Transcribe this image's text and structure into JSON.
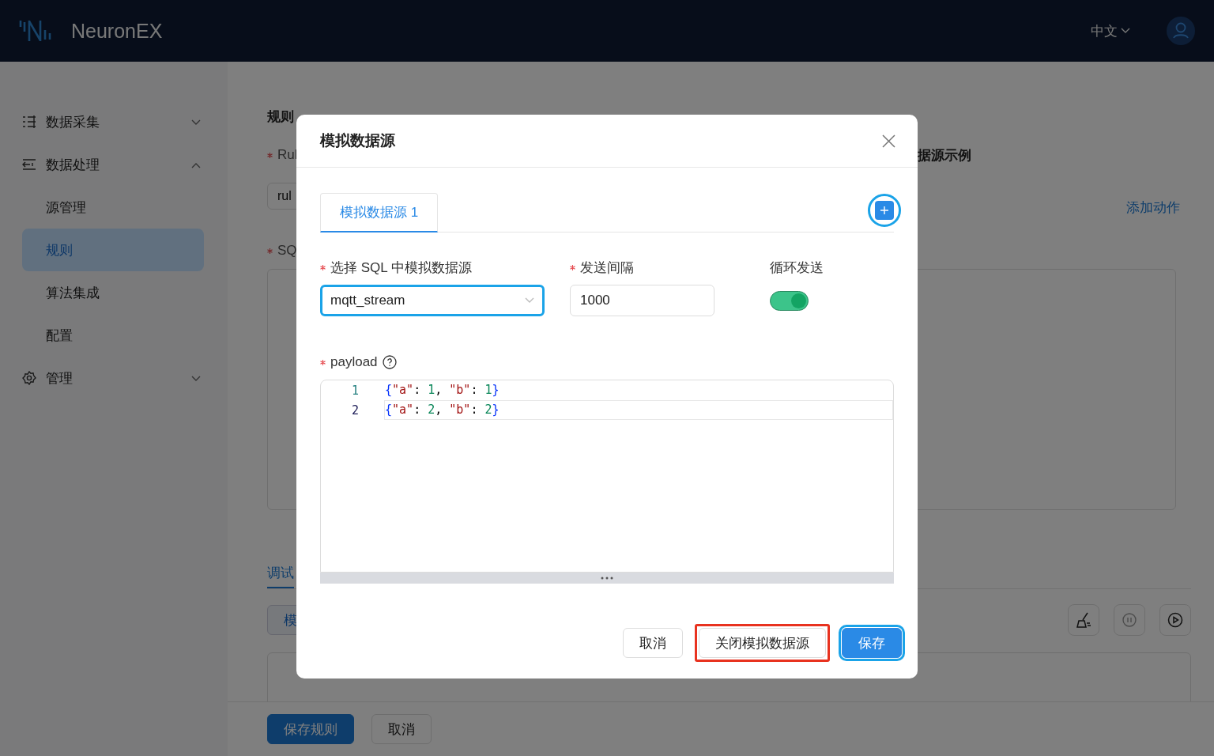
{
  "header": {
    "brand": "NeuronEX",
    "language": "中文"
  },
  "sidebar": {
    "items": [
      {
        "label": "数据采集",
        "expanded": false
      },
      {
        "label": "数据处理",
        "expanded": true,
        "children": [
          {
            "label": "源管理",
            "selected": false
          },
          {
            "label": "规则",
            "selected": true
          },
          {
            "label": "算法集成",
            "selected": false
          },
          {
            "label": "配置",
            "selected": false
          }
        ]
      },
      {
        "label": "管理",
        "expanded": false
      }
    ]
  },
  "page": {
    "breadcrumb": [
      "规则"
    ],
    "rule_field": {
      "label": "Rul",
      "required": true,
      "value": "rul"
    },
    "right_heading": "据源示例",
    "add_action": "添加动作",
    "sql_field": {
      "label": "SQ",
      "required": true
    },
    "tabs": [
      {
        "label": "调试",
        "selected": true
      }
    ],
    "mock_button": "模",
    "footer_buttons": [
      {
        "label": "保存规则",
        "kind": "primary"
      },
      {
        "label": "取消",
        "kind": "default"
      }
    ]
  },
  "modal": {
    "title": "模拟数据源",
    "tabs": [
      {
        "label": "模拟数据源 1",
        "selected": true
      }
    ],
    "add_button": {
      "focused": true
    },
    "fields": [
      {
        "kind": "select",
        "label": "选择 SQL 中模拟数据源",
        "required": true,
        "value": "mqtt_stream",
        "focused": true
      },
      {
        "kind": "input",
        "label": "发送间隔",
        "required": true,
        "value": "1000",
        "focused": false
      },
      {
        "kind": "switch",
        "label": "循环发送",
        "required": false,
        "on": true
      }
    ],
    "payload": {
      "label": "payload",
      "required": true,
      "lines": [
        {
          "number": "1",
          "code": "{\"a\": 1, \"b\": 1}",
          "current": false
        },
        {
          "number": "2",
          "code": "{\"a\": 2, \"b\": 2}",
          "current": true
        }
      ]
    },
    "buttons": [
      {
        "label": "取消",
        "kind": "default",
        "highlighted": false,
        "focused": false
      },
      {
        "label": "关闭模拟数据源",
        "kind": "default",
        "highlighted": true,
        "focused": false
      },
      {
        "label": "保存",
        "kind": "primary",
        "highlighted": false,
        "focused": true
      }
    ]
  }
}
